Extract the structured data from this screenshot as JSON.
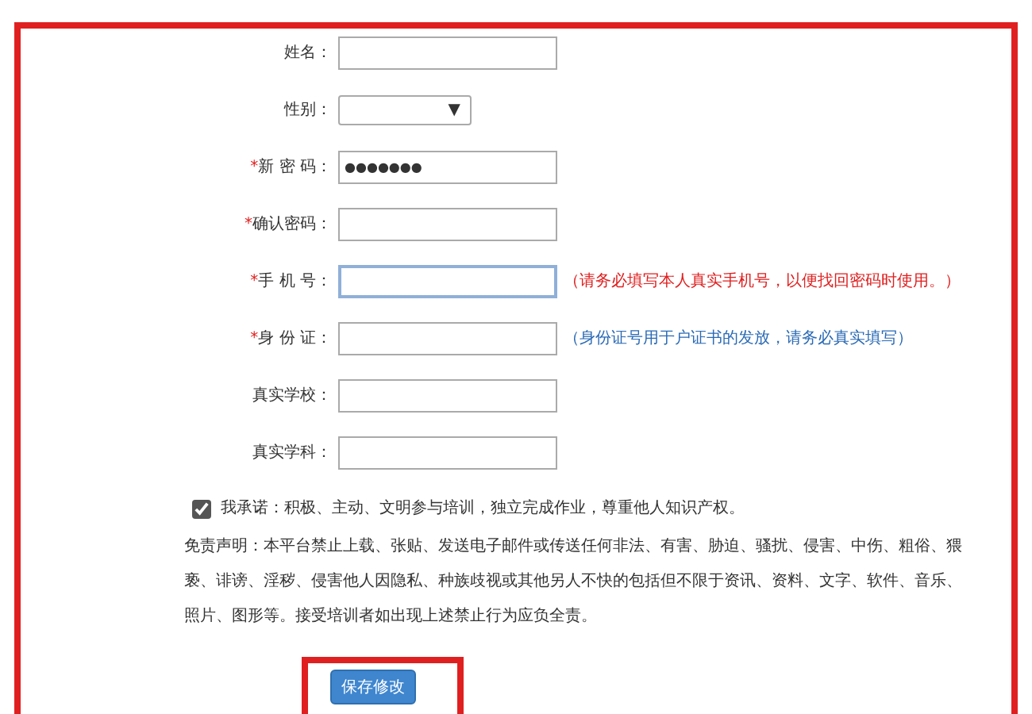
{
  "form": {
    "fields": [
      {
        "label": "姓名：",
        "kind": "text"
      },
      {
        "label": "性别：",
        "kind": "select",
        "arrow": "▼"
      },
      {
        "label": "新 密 码：",
        "mark": "*",
        "kind": "password",
        "value": "●●●●●●●"
      },
      {
        "label": "确认密码：",
        "mark": "*",
        "kind": "text"
      },
      {
        "label": "手 机 号：",
        "mark": "*",
        "kind": "text",
        "focused": true,
        "hint": "（请务必填写本人真实手机号，以便找回密码时使用。）",
        "color": "#e02020"
      },
      {
        "label": "身 份 证：",
        "mark": "*",
        "kind": "text",
        "hint": "（身份证号用于户证书的发放，请务必真实填写）",
        "color": "#2a6ab5"
      },
      {
        "label": "真实学校：",
        "kind": "text"
      },
      {
        "label": "真实学科：",
        "kind": "text"
      }
    ],
    "pledge": {
      "checked": true,
      "text": "我承诺：积极、主动、文明参与培训，独立完成作业，尊重他人知识产权。"
    },
    "disclaimer": "免责声明：本平台禁止上载、张贴、发送电子邮件或传送任何非法、有害、胁迫、骚扰、侵害、中伤、粗俗、猥亵、诽谤、淫秽、侵害他人因隐私、种族歧视或其他另人不快的包括但不限于资讯、资料、文字、软件、音乐、照片、图形等。接受培训者如出现上述禁止行为应负全责。",
    "save_button": "保存修改"
  }
}
